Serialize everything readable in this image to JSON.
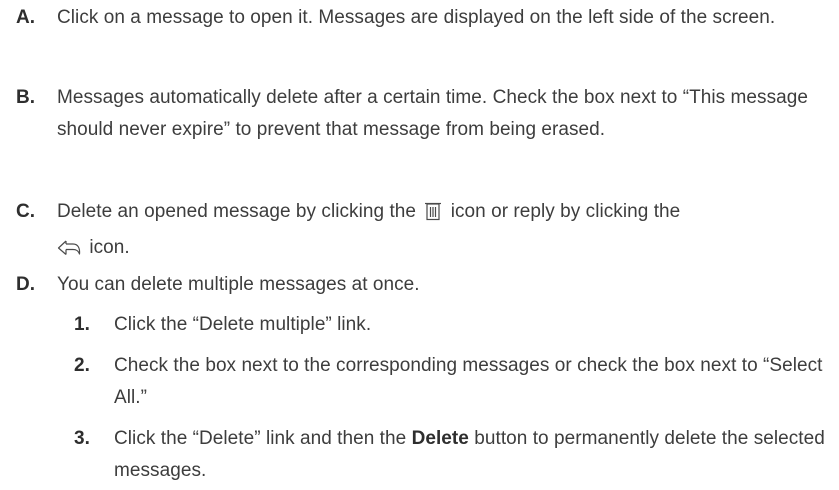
{
  "instructions": [
    {
      "letter": "A.",
      "text": "Click on a message to open it. Messages are displayed on the left side of the screen."
    },
    {
      "letter": "B.",
      "text": "Messages automatically delete after a certain time. Check the box next to “This message should never expire” to prevent that message from being erased."
    },
    {
      "letter": "C.",
      "text_before_trash": "Delete an opened message by clicking the",
      "text_after_trash": "icon or reply by clicking the",
      "text_after_reply": "icon.",
      "trash_icon": "trash-icon",
      "reply_icon": "reply-icon"
    },
    {
      "letter": "D.",
      "text": "You can delete multiple messages at once.",
      "steps": [
        {
          "number": "1.",
          "text": "Click the “Delete multiple” link."
        },
        {
          "number": "2.",
          "text": "Check the box next to the corresponding messages or check the box next to “Select All.”"
        },
        {
          "number": "3.",
          "text_before_bold": "Click the “Delete” link and then the",
          "bold": "Delete",
          "text_after_bold": "button to permanently delete the selected messages."
        }
      ]
    }
  ],
  "colors": {
    "text": "#3d3d3d",
    "label": "#2e2e2e"
  }
}
